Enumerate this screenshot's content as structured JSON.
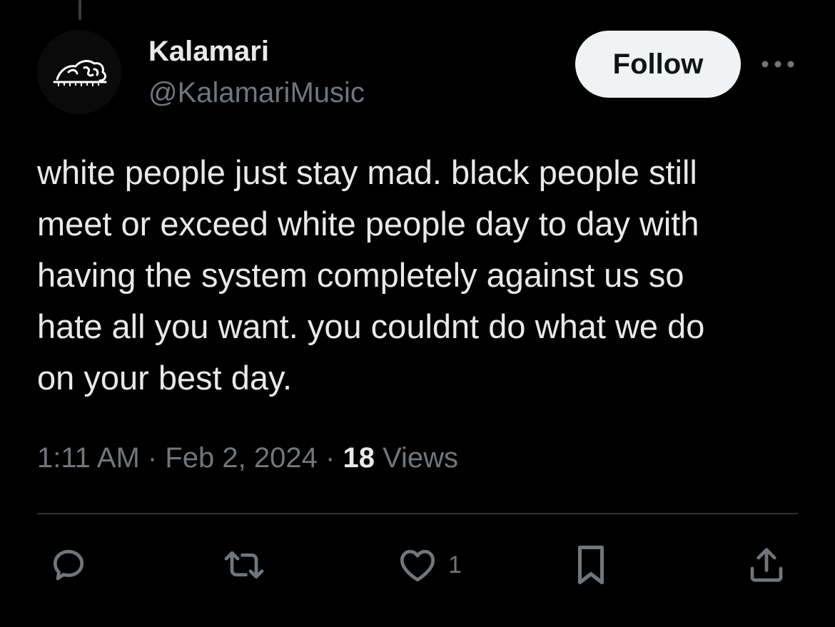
{
  "author": {
    "display_name": "Kalamari",
    "handle": "@KalamariMusic",
    "avatar_icon": "elephant-logo-avatar"
  },
  "follow_label": "Follow",
  "more_icon": "ellipsis-icon",
  "tweet": {
    "text": "white people just stay mad. black people still\nmeet or exceed white people day to day with\nhaving the system completely against us so\nhate all you want. you couldnt do what we do\non your best day.",
    "time": "1:11 AM",
    "separator": "·",
    "date": "Feb 2, 2024",
    "views_count": "18",
    "views_label": "Views"
  },
  "actions": {
    "reply_icon": "reply-bubble-icon",
    "retweet_icon": "retweet-icon",
    "like_icon": "heart-icon",
    "like_count": "1",
    "bookmark_icon": "bookmark-icon",
    "share_icon": "share-icon"
  },
  "colors": {
    "background": "#000000",
    "primary_text": "#e7e9ea",
    "secondary_text": "#71767b",
    "follow_bg": "#eff3f4",
    "divider": "#2f3336"
  }
}
